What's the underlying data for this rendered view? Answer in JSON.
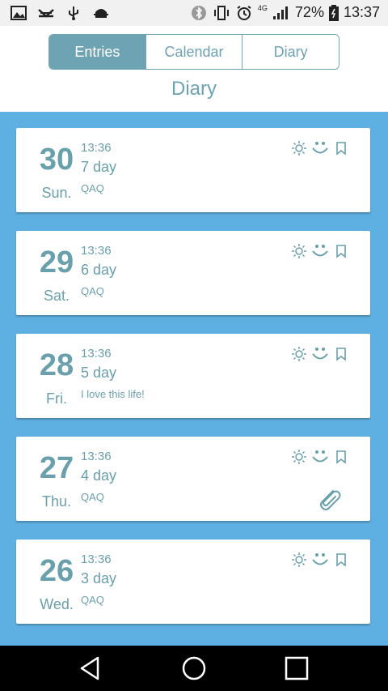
{
  "status_bar": {
    "battery_percent": "72%",
    "clock": "13:37",
    "network": "4G",
    "left_icons": [
      "image-icon",
      "missed-call-icon",
      "usb-icon",
      "android-debug-icon"
    ],
    "right_icons": [
      "bluetooth-icon",
      "vibrate-icon",
      "alarm-icon",
      "signal-icon",
      "battery-icon"
    ]
  },
  "tabs": [
    {
      "label": "Entries",
      "active": true
    },
    {
      "label": "Calendar",
      "active": false
    },
    {
      "label": "Diary",
      "active": false
    }
  ],
  "page_title": "Diary",
  "entries": [
    {
      "day": "30",
      "weekday": "Sun.",
      "time": "13:36",
      "title": "7 day",
      "text": "QAQ",
      "has_attachment": false
    },
    {
      "day": "29",
      "weekday": "Sat.",
      "time": "13:36",
      "title": "6 day",
      "text": "QAQ",
      "has_attachment": false
    },
    {
      "day": "28",
      "weekday": "Fri.",
      "time": "13:36",
      "title": "5 day",
      "text": "I love this life!",
      "has_attachment": false
    },
    {
      "day": "27",
      "weekday": "Thu.",
      "time": "13:36",
      "title": "4 day",
      "text": "QAQ",
      "has_attachment": true
    },
    {
      "day": "26",
      "weekday": "Wed.",
      "time": "13:36",
      "title": "3 day",
      "text": "QAQ",
      "has_attachment": false
    }
  ],
  "entry_icons": [
    "sun-icon",
    "smile-icon",
    "bookmark-icon"
  ],
  "colors": {
    "accent": "#6ea3b3",
    "content_background": "#5fb0e2",
    "card_text": "#6a9fac"
  },
  "nav": [
    "back-icon",
    "home-icon",
    "recents-icon"
  ]
}
